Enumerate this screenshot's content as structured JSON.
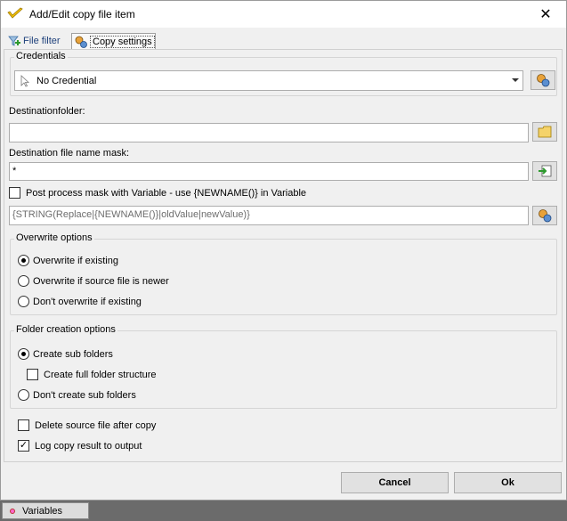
{
  "window": {
    "title": "Add/Edit copy file item",
    "close_glyph": "✕"
  },
  "tabs": [
    {
      "label": "File filter",
      "icon": "funnel-plus-icon"
    },
    {
      "label": "Copy settings",
      "icon": "gears-icon",
      "active": true
    }
  ],
  "credentials": {
    "legend": "Credentials",
    "selected": "No Credential"
  },
  "destination_folder": {
    "label": "Destinationfolder:",
    "value": ""
  },
  "file_name_mask": {
    "label": "Destination file name mask:",
    "value": "*"
  },
  "post_process": {
    "label": "Post process mask with Variable - use {NEWNAME()} in Variable",
    "checked": false,
    "value": "{STRING(Replace|{NEWNAME()}|oldValue|newValue)}"
  },
  "overwrite": {
    "legend": "Overwrite options",
    "options": [
      {
        "label": "Overwrite if existing",
        "selected": true
      },
      {
        "label": "Overwrite if source file is newer",
        "selected": false
      },
      {
        "label": "Don't overwrite if existing",
        "selected": false
      }
    ]
  },
  "folder_creation": {
    "legend": "Folder creation options",
    "create_sub": "Create sub folders",
    "full_structure": "Create full folder structure",
    "dont_create": "Don't create sub folders"
  },
  "delete_source": {
    "label": "Delete source file after copy",
    "checked": false
  },
  "log_result": {
    "label": "Log copy result to output",
    "checked": true,
    "mark": "✓"
  },
  "buttons": {
    "cancel": "Cancel",
    "ok": "Ok"
  },
  "statusbar": {
    "variables_tab": "Variables"
  }
}
